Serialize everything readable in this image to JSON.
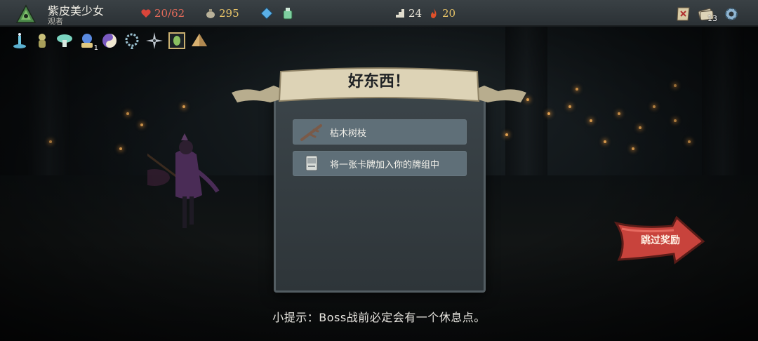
{
  "player": {
    "name": "紫皮美少女",
    "title": "观者",
    "hp": "20/62",
    "gold": "295",
    "floor": "24",
    "ascension": "20",
    "deck_count": "13",
    "potions": [
      "blue-potion-icon",
      "green-potion-icon"
    ]
  },
  "relics": [
    {
      "name": "relic-blue-candle-icon"
    },
    {
      "name": "relic-golden-idol-icon"
    },
    {
      "name": "relic-mushroom-icon"
    },
    {
      "name": "relic-blue-orb-icon",
      "count": "1"
    },
    {
      "name": "relic-yin-yang-icon"
    },
    {
      "name": "relic-rope-icon"
    },
    {
      "name": "relic-shuriken-icon"
    },
    {
      "name": "relic-beetle-frame-icon"
    },
    {
      "name": "relic-pyramid-icon"
    }
  ],
  "reward_panel": {
    "title": "好东西！",
    "rewards": [
      {
        "label": "枯木树枝",
        "icon": "dead-branch-icon"
      },
      {
        "label": "将一张卡牌加入你的牌组中",
        "icon": "card-icon"
      }
    ]
  },
  "skip_button": {
    "label": "跳过奖励"
  },
  "tip": "小提示：Boss战前必定会有一个休息点。",
  "colors": {
    "hp": "#e26a5a",
    "gold": "#e8c468",
    "panel": "#3b4449",
    "reward_row": "#5f6f78",
    "skip_button": "#c8433c"
  }
}
